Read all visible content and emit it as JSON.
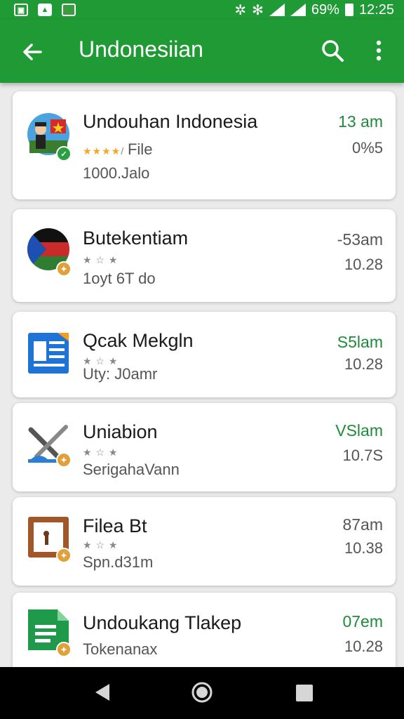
{
  "status_bar": {
    "left_icons": [
      "image-icon",
      "navigation-icon",
      "app-notification-icon"
    ],
    "battery": "69%",
    "time": "12:25"
  },
  "app_bar": {
    "title": "Undonesiian",
    "back_icon": "arrow-back-icon",
    "search_icon": "search-icon",
    "more_icon": "more-vert-icon"
  },
  "items": [
    {
      "name": "Undouhan Indonesia",
      "rating_label": "File",
      "subtitle": "1000.Jalo",
      "time": "13 am",
      "size": "0%5",
      "icon": "user-flag-icon",
      "badge_color": "#2aa043"
    },
    {
      "name": "Butekentiam",
      "rating_label": "",
      "subtitle": "1oyt 6T do",
      "time": "-53am",
      "size": "10.28",
      "icon": "flag-icon",
      "badge_color": "#e0a13a"
    },
    {
      "name": "Qcak Mekgln",
      "rating_label": "",
      "subtitle": "Uty: J0amr",
      "time": "S5lam",
      "size": "10.28",
      "icon": "document-icon",
      "badge_color": "#e0a13a"
    },
    {
      "name": "Uniabion",
      "rating_label": "",
      "subtitle": "SerigahaVann",
      "time": "VSlam",
      "size": "10.7S",
      "icon": "tools-icon",
      "badge_color": "#e0a13a"
    },
    {
      "name": "Filea Bt",
      "rating_label": "",
      "subtitle": "Spn.d31m",
      "time": "87am",
      "size": "10.38",
      "icon": "keyhole-icon",
      "badge_color": "#e0a13a"
    },
    {
      "name": "Undoukang Tlakep",
      "rating_label": "",
      "subtitle": "Tokenanax",
      "time": "07em",
      "size": "10.28",
      "icon": "sheets-icon",
      "badge_color": "#e0a13a"
    }
  ],
  "colors": {
    "primary": "#1f9a35",
    "accent_text": "#1f8a3a",
    "star": "#f5a623"
  },
  "nav": {
    "back_icon": "nav-back-icon",
    "home_icon": "nav-home-icon",
    "recents_icon": "nav-recents-icon"
  }
}
